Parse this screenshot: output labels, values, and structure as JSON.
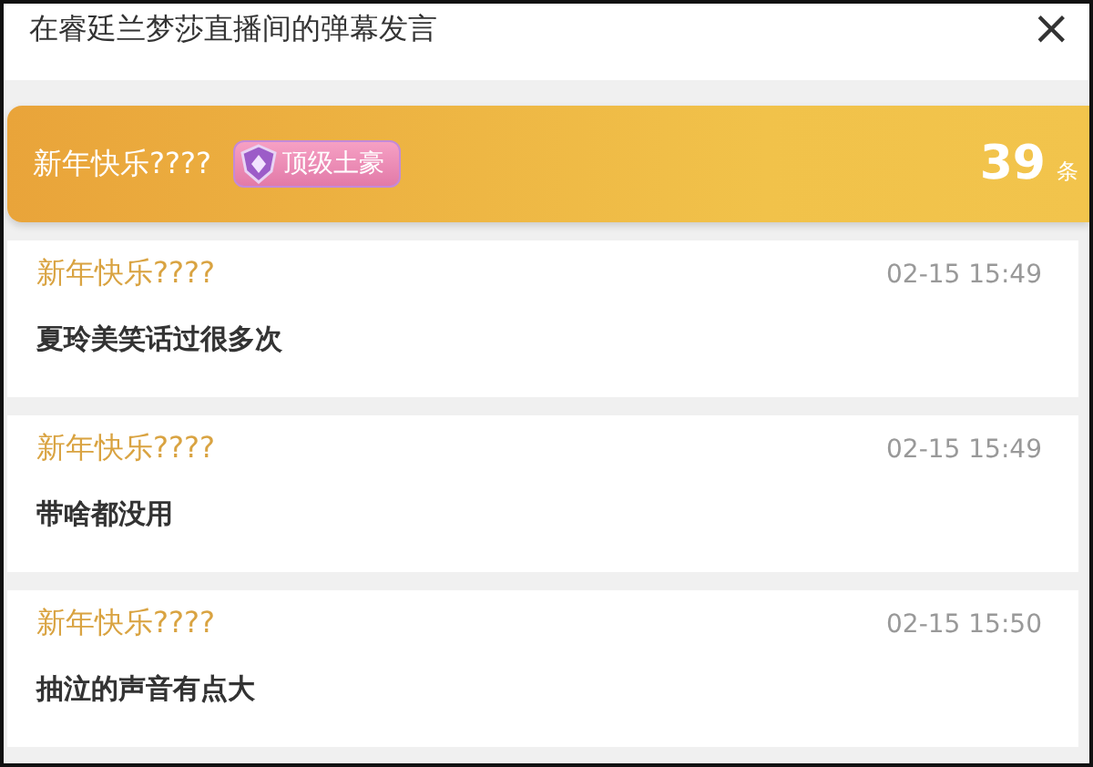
{
  "window": {
    "title": "在睿廷兰梦莎直播间的弹幕发言",
    "close": "×"
  },
  "banner": {
    "user": "新年快乐????",
    "badge": "顶级土豪",
    "count": "39",
    "unit": "条"
  },
  "messages": [
    {
      "user": "新年快乐????",
      "time": "02-15 15:49",
      "text": "夏玲美笑话过很多次"
    },
    {
      "user": "新年快乐????",
      "time": "02-15 15:49",
      "text": "带啥都没用"
    },
    {
      "user": "新年快乐????",
      "time": "02-15 15:50",
      "text": "抽泣的声音有点大"
    }
  ]
}
